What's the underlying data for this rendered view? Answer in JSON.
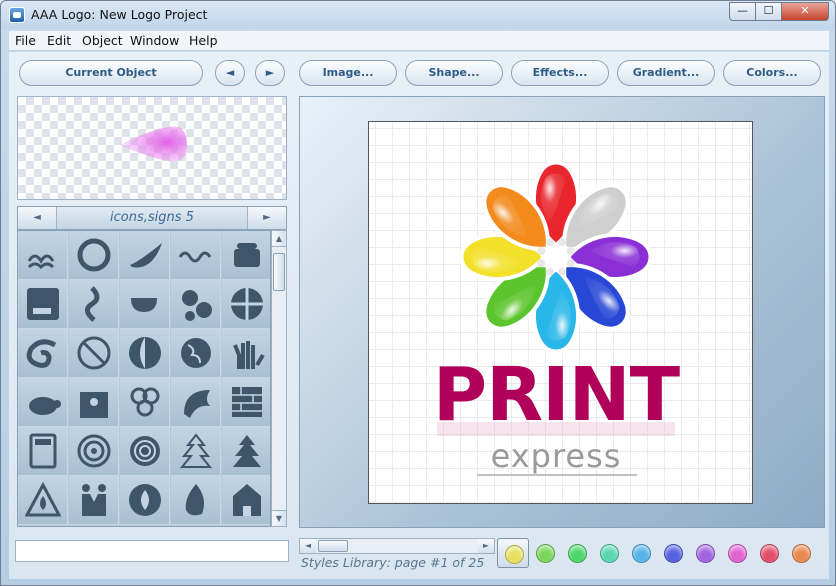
{
  "window": {
    "title": "AAA Logo: New Logo Project",
    "min": "—",
    "max": "☐",
    "close": "✕"
  },
  "menu": [
    "File",
    "Edit",
    "Object",
    "Window",
    "Help"
  ],
  "toolbar": {
    "current_object": "Current Object",
    "prev": "◄",
    "next": "►",
    "image": "Image...",
    "shape": "Shape...",
    "effects": "Effects...",
    "gradient": "Gradient...",
    "colors": "Colors..."
  },
  "library": {
    "title": "icons,signs 5",
    "prev": "◄",
    "next": "►",
    "icons": [
      "waves-icon",
      "swirl-ring-icon",
      "swoosh-icon",
      "wave-line-icon",
      "telephone-icon",
      "coffee-cup-icon",
      "s-curve-icon",
      "teacup-icon",
      "gears-icon",
      "spiral-tribal-icon",
      "curl-wave-icon",
      "no-smoking-icon",
      "moon-icon",
      "globe-icon",
      "hand-print-icon",
      "turtle-icon",
      "family-icon",
      "clover-icon",
      "shell-icon",
      "brick-wall-icon",
      "calculator-icon",
      "spiral-icon",
      "spiral-2-icon",
      "christmas-tree-icon",
      "christmas-tree-2-icon",
      "fire-warning-icon",
      "handshake-icon",
      "fire-circle-icon",
      "flame-icon",
      "church-icon"
    ]
  },
  "canvas": {
    "logo_text": "PRINT",
    "logo_subtext": "express"
  },
  "styles_library": {
    "text": "Styles Library: page #1 of 25"
  },
  "swatches": [
    "#e8e060",
    "#7ad65a",
    "#4cd66a",
    "#59d6b0",
    "#56b3e8",
    "#5560e0",
    "#a064e0",
    "#e063d0",
    "#e0506a",
    "#e8894f"
  ],
  "colors": {
    "accent_text": "#2f5c86",
    "logo_text": "#b0005a",
    "logo_subtext": "#9a9a9a",
    "petal_colors": [
      "#e8262c",
      "#cfcfcf",
      "#8a2fd6",
      "#2747d6",
      "#29b6e8",
      "#5cc42c",
      "#f2e02a",
      "#f28a1c"
    ]
  }
}
